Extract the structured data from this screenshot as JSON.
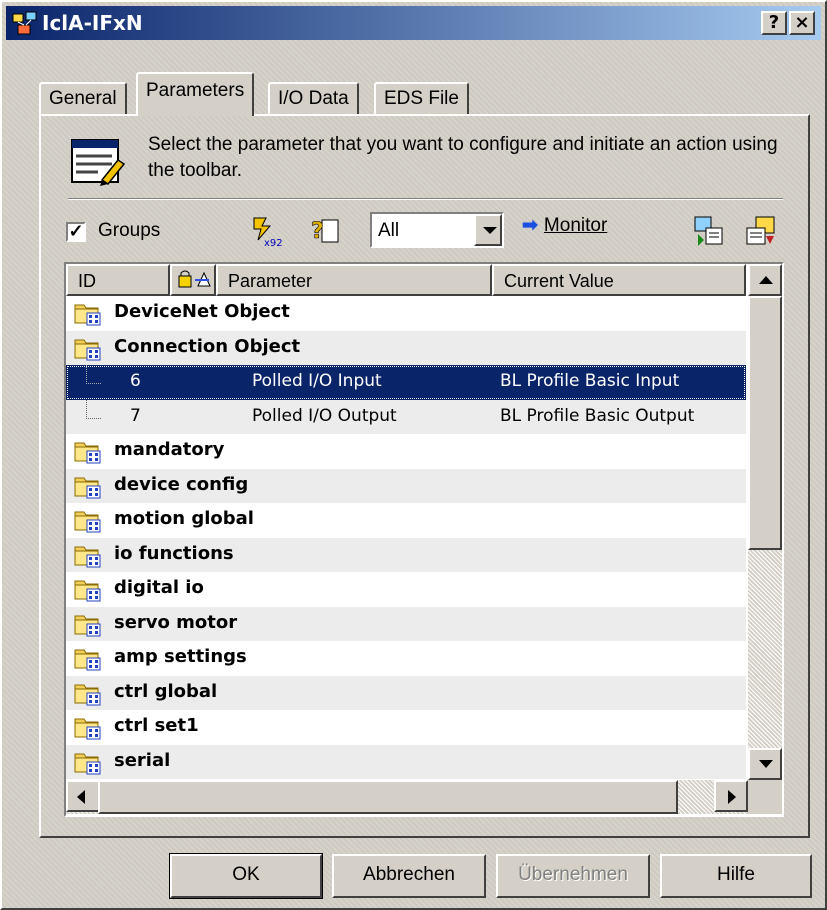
{
  "window": {
    "title": "IclA-IFxN",
    "help_glyph": "?",
    "close_glyph": "×"
  },
  "tabs": [
    {
      "label": "General",
      "active": false
    },
    {
      "label": "Parameters",
      "active": true
    },
    {
      "label": "I/O Data",
      "active": false
    },
    {
      "label": "EDS File",
      "active": false
    }
  ],
  "description": "Select the parameter that you want to configure and initiate an action using the toolbar.",
  "toolbar": {
    "groups_checked": true,
    "groups_label": "Groups",
    "filter_value": "All",
    "monitor_arrow": "➡",
    "monitor_label": "Monitor",
    "icons": [
      "sort-icon",
      "help-icon",
      "download-icon",
      "upload-icon"
    ]
  },
  "list": {
    "headers": {
      "id": "ID",
      "parameter": "Parameter",
      "current_value": "Current Value"
    },
    "rows": [
      {
        "type": "group",
        "label": "DeviceNet Object",
        "expanded": false
      },
      {
        "type": "group",
        "label": "Connection Object",
        "expanded": true
      },
      {
        "type": "param",
        "id": "6",
        "parameter": "Polled I/O Input",
        "value": "BL Profile Basic Input",
        "selected": true
      },
      {
        "type": "param",
        "id": "7",
        "parameter": "Polled I/O Output",
        "value": "BL Profile Basic Output",
        "selected": false
      },
      {
        "type": "group",
        "label": "mandatory"
      },
      {
        "type": "group",
        "label": "device config"
      },
      {
        "type": "group",
        "label": "motion global"
      },
      {
        "type": "group",
        "label": "io functions"
      },
      {
        "type": "group",
        "label": "digital io"
      },
      {
        "type": "group",
        "label": "servo motor"
      },
      {
        "type": "group",
        "label": "amp settings"
      },
      {
        "type": "group",
        "label": "ctrl global"
      },
      {
        "type": "group",
        "label": "ctrl set1"
      },
      {
        "type": "group",
        "label": "serial"
      }
    ]
  },
  "buttons": {
    "ok": "OK",
    "cancel": "Abbrechen",
    "apply": "Übernehmen",
    "help": "Hilfe"
  },
  "colors": {
    "titlebar_start": "#0a246a",
    "titlebar_end": "#a6caf0",
    "selection": "#0a246a",
    "face": "#d4d0c8"
  }
}
